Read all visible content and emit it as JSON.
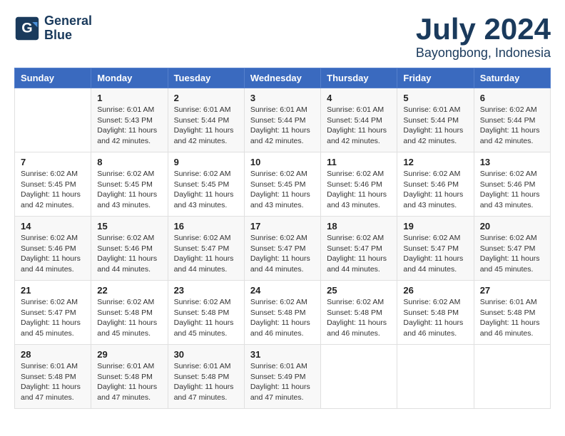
{
  "logo": {
    "name_line1": "General",
    "name_line2": "Blue"
  },
  "header": {
    "month": "July 2024",
    "location": "Bayongbong, Indonesia"
  },
  "columns": [
    "Sunday",
    "Monday",
    "Tuesday",
    "Wednesday",
    "Thursday",
    "Friday",
    "Saturday"
  ],
  "weeks": [
    [
      {
        "day": "",
        "info": ""
      },
      {
        "day": "1",
        "info": "Sunrise: 6:01 AM\nSunset: 5:43 PM\nDaylight: 11 hours\nand 42 minutes."
      },
      {
        "day": "2",
        "info": "Sunrise: 6:01 AM\nSunset: 5:44 PM\nDaylight: 11 hours\nand 42 minutes."
      },
      {
        "day": "3",
        "info": "Sunrise: 6:01 AM\nSunset: 5:44 PM\nDaylight: 11 hours\nand 42 minutes."
      },
      {
        "day": "4",
        "info": "Sunrise: 6:01 AM\nSunset: 5:44 PM\nDaylight: 11 hours\nand 42 minutes."
      },
      {
        "day": "5",
        "info": "Sunrise: 6:01 AM\nSunset: 5:44 PM\nDaylight: 11 hours\nand 42 minutes."
      },
      {
        "day": "6",
        "info": "Sunrise: 6:02 AM\nSunset: 5:44 PM\nDaylight: 11 hours\nand 42 minutes."
      }
    ],
    [
      {
        "day": "7",
        "info": "Sunrise: 6:02 AM\nSunset: 5:45 PM\nDaylight: 11 hours\nand 42 minutes."
      },
      {
        "day": "8",
        "info": "Sunrise: 6:02 AM\nSunset: 5:45 PM\nDaylight: 11 hours\nand 43 minutes."
      },
      {
        "day": "9",
        "info": "Sunrise: 6:02 AM\nSunset: 5:45 PM\nDaylight: 11 hours\nand 43 minutes."
      },
      {
        "day": "10",
        "info": "Sunrise: 6:02 AM\nSunset: 5:45 PM\nDaylight: 11 hours\nand 43 minutes."
      },
      {
        "day": "11",
        "info": "Sunrise: 6:02 AM\nSunset: 5:46 PM\nDaylight: 11 hours\nand 43 minutes."
      },
      {
        "day": "12",
        "info": "Sunrise: 6:02 AM\nSunset: 5:46 PM\nDaylight: 11 hours\nand 43 minutes."
      },
      {
        "day": "13",
        "info": "Sunrise: 6:02 AM\nSunset: 5:46 PM\nDaylight: 11 hours\nand 43 minutes."
      }
    ],
    [
      {
        "day": "14",
        "info": "Sunrise: 6:02 AM\nSunset: 5:46 PM\nDaylight: 11 hours\nand 44 minutes."
      },
      {
        "day": "15",
        "info": "Sunrise: 6:02 AM\nSunset: 5:46 PM\nDaylight: 11 hours\nand 44 minutes."
      },
      {
        "day": "16",
        "info": "Sunrise: 6:02 AM\nSunset: 5:47 PM\nDaylight: 11 hours\nand 44 minutes."
      },
      {
        "day": "17",
        "info": "Sunrise: 6:02 AM\nSunset: 5:47 PM\nDaylight: 11 hours\nand 44 minutes."
      },
      {
        "day": "18",
        "info": "Sunrise: 6:02 AM\nSunset: 5:47 PM\nDaylight: 11 hours\nand 44 minutes."
      },
      {
        "day": "19",
        "info": "Sunrise: 6:02 AM\nSunset: 5:47 PM\nDaylight: 11 hours\nand 44 minutes."
      },
      {
        "day": "20",
        "info": "Sunrise: 6:02 AM\nSunset: 5:47 PM\nDaylight: 11 hours\nand 45 minutes."
      }
    ],
    [
      {
        "day": "21",
        "info": "Sunrise: 6:02 AM\nSunset: 5:47 PM\nDaylight: 11 hours\nand 45 minutes."
      },
      {
        "day": "22",
        "info": "Sunrise: 6:02 AM\nSunset: 5:48 PM\nDaylight: 11 hours\nand 45 minutes."
      },
      {
        "day": "23",
        "info": "Sunrise: 6:02 AM\nSunset: 5:48 PM\nDaylight: 11 hours\nand 45 minutes."
      },
      {
        "day": "24",
        "info": "Sunrise: 6:02 AM\nSunset: 5:48 PM\nDaylight: 11 hours\nand 46 minutes."
      },
      {
        "day": "25",
        "info": "Sunrise: 6:02 AM\nSunset: 5:48 PM\nDaylight: 11 hours\nand 46 minutes."
      },
      {
        "day": "26",
        "info": "Sunrise: 6:02 AM\nSunset: 5:48 PM\nDaylight: 11 hours\nand 46 minutes."
      },
      {
        "day": "27",
        "info": "Sunrise: 6:01 AM\nSunset: 5:48 PM\nDaylight: 11 hours\nand 46 minutes."
      }
    ],
    [
      {
        "day": "28",
        "info": "Sunrise: 6:01 AM\nSunset: 5:48 PM\nDaylight: 11 hours\nand 47 minutes."
      },
      {
        "day": "29",
        "info": "Sunrise: 6:01 AM\nSunset: 5:48 PM\nDaylight: 11 hours\nand 47 minutes."
      },
      {
        "day": "30",
        "info": "Sunrise: 6:01 AM\nSunset: 5:48 PM\nDaylight: 11 hours\nand 47 minutes."
      },
      {
        "day": "31",
        "info": "Sunrise: 6:01 AM\nSunset: 5:49 PM\nDaylight: 11 hours\nand 47 minutes."
      },
      {
        "day": "",
        "info": ""
      },
      {
        "day": "",
        "info": ""
      },
      {
        "day": "",
        "info": ""
      }
    ]
  ]
}
